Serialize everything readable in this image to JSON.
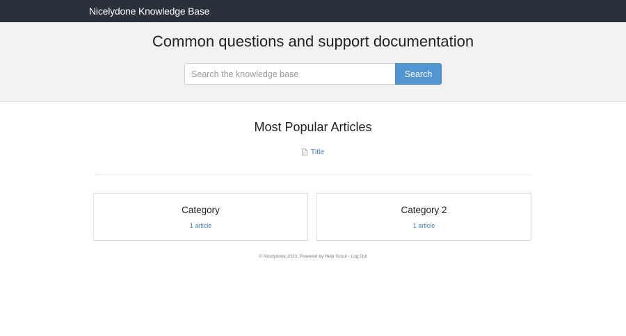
{
  "header": {
    "brand": "Nicelydone Knowledge Base"
  },
  "hero": {
    "title": "Common questions and support documentation",
    "search_placeholder": "Search the knowledge base",
    "search_button": "Search"
  },
  "popular": {
    "heading": "Most Popular Articles",
    "articles": [
      {
        "title": "Title",
        "icon": "document-icon"
      }
    ]
  },
  "categories": [
    {
      "name": "Category",
      "count": "1 article"
    },
    {
      "name": "Category 2",
      "count": "1 article"
    }
  ],
  "footer": {
    "copyright": "© Nicelydone 2023. Powered by",
    "powered_link": "Help Scout",
    "separator": "-",
    "logout": "Log Out"
  },
  "colors": {
    "topbar": "#2b313b",
    "accent": "#5195d1",
    "link": "#3a7ab8",
    "hero_bg": "#f2f2f2"
  }
}
